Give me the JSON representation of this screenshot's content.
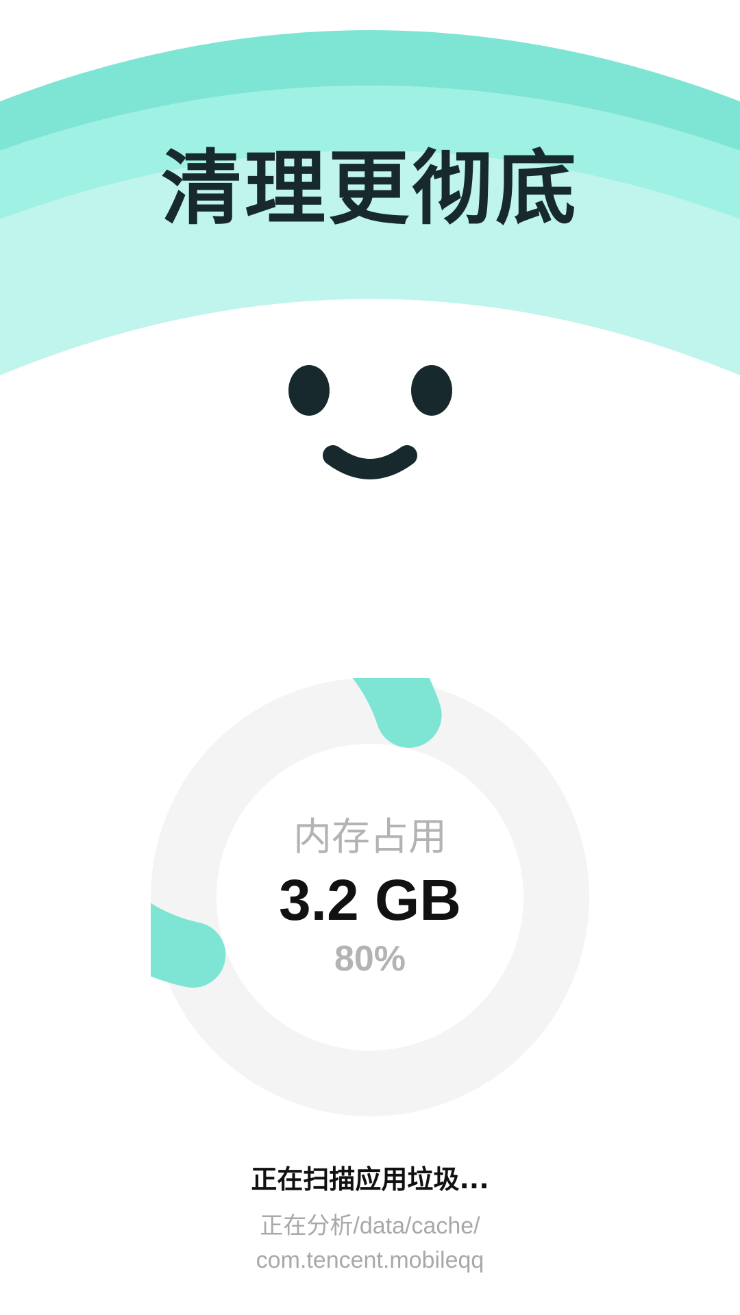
{
  "colors": {
    "arc_outer": "#7ee5d5",
    "arc_middle": "#9ff1e4",
    "arc_inner": "#bff5ec",
    "face": "#17292c",
    "ring_fill": "#7ee5d5",
    "ring_track": "#f4f4f4",
    "headline_text": "#17292c",
    "muted_text": "#b3b3b3"
  },
  "banner": {
    "headline": "清理更彻底",
    "mascot_icon": "smiley-face-icon"
  },
  "memory": {
    "label": "内存占用",
    "value": "3.2 GB",
    "percent_text": "80%",
    "progress_fraction": 0.8
  },
  "scan": {
    "status": "正在扫描应用垃圾...",
    "path_line1": "正在分析/data/cache/",
    "path_line2": "com.tencent.mobileqq"
  }
}
